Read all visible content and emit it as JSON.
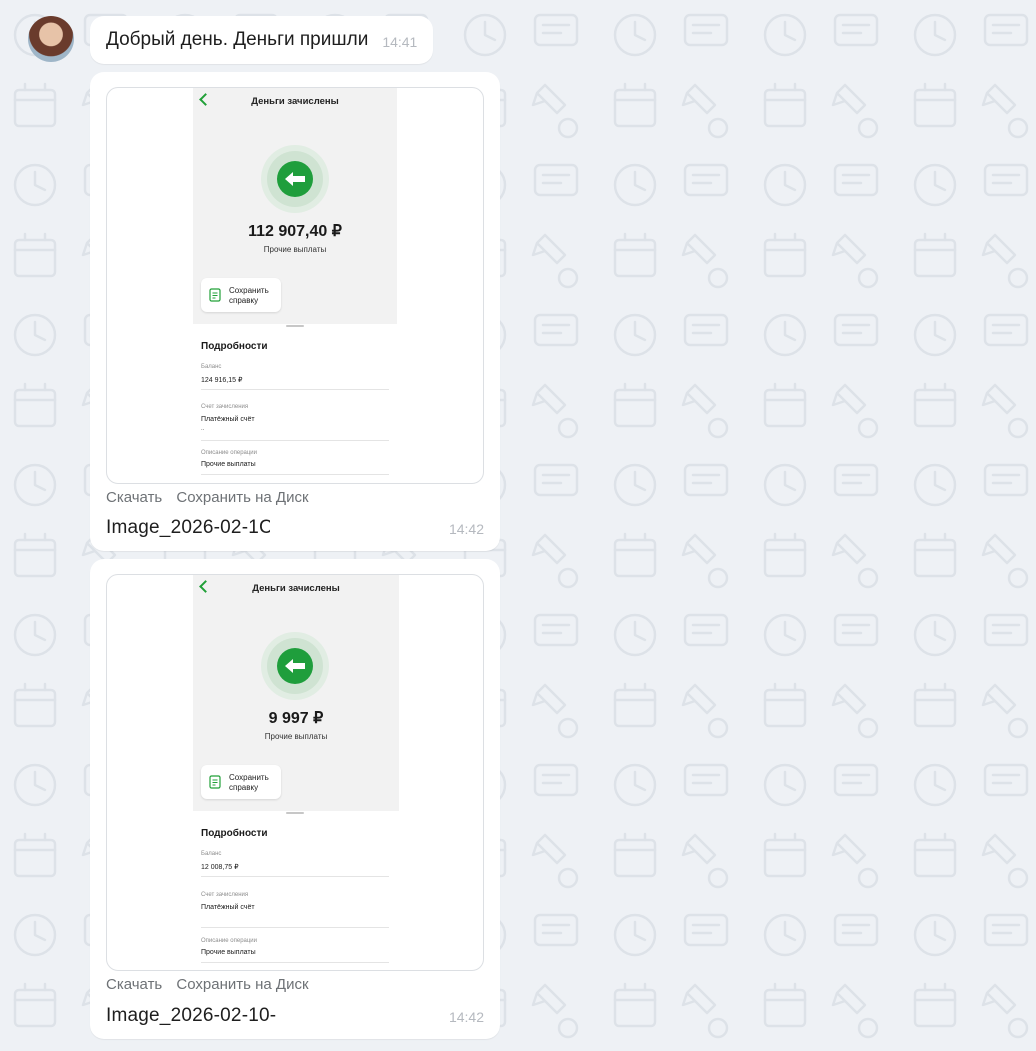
{
  "message": {
    "text": "Добрый день. Деньги пришли",
    "time": "14:41"
  },
  "attachments": [
    {
      "screen_title": "Деньги зачислены",
      "amount": "112 907,40 ₽",
      "amount_caption": "Прочие выплаты",
      "save_label_1": "Сохранить",
      "save_label_2": "справку",
      "details_title": "Подробности",
      "balance_label": "Баланс",
      "balance_value": "124 916,15 ₽",
      "account_label": "Счет зачисления",
      "account_value": "Платёжный счёт",
      "account_dots": "..",
      "description_label": "Описание операции",
      "description_value": "Прочие выплаты",
      "download_label": "Скачать",
      "save_disk_label": "Сохранить на Диск",
      "filename": "Image_2026-02-1С",
      "time": "14:42"
    },
    {
      "screen_title": "Деньги зачислены",
      "amount": "9 997 ₽",
      "amount_caption": "Прочие выплаты",
      "save_label_1": "Сохранить",
      "save_label_2": "справку",
      "details_title": "Подробности",
      "balance_label": "Баланс",
      "balance_value": "12 008,75 ₽",
      "account_label": "Счет зачисления",
      "account_value": "Платёжный счёт",
      "description_label": "Описание операции",
      "description_value": "Прочие выплаты",
      "download_label": "Скачать",
      "save_disk_label": "Сохранить на Диск",
      "filename": "Image_2026-02-10-",
      "time": "14:42"
    }
  ],
  "colors": {
    "accent_green": "#21a038",
    "chat_background": "#eef1f5",
    "bubble": "#ffffff"
  }
}
